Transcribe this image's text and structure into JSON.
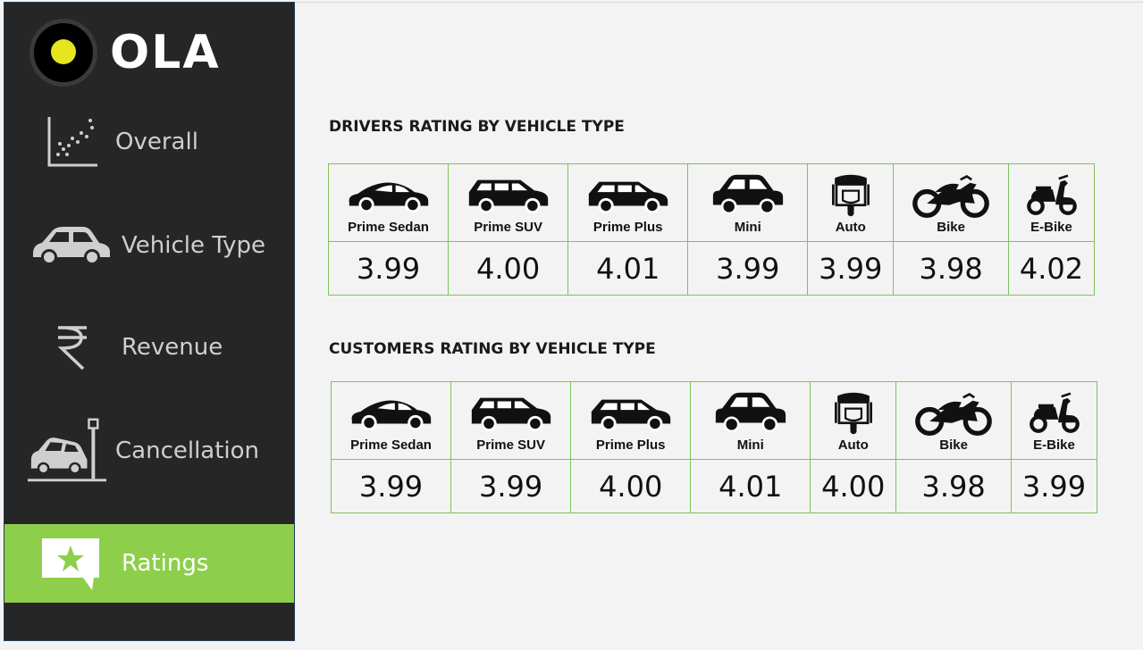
{
  "brand": {
    "logo_text": "OLA",
    "accent": "#8dcf4b",
    "logo_dot": "#e5e61f"
  },
  "nav": {
    "items": [
      {
        "label": "Overall",
        "icon": "scatter-chart-icon",
        "active": false
      },
      {
        "label": "Vehicle Type",
        "icon": "car-icon",
        "active": false
      },
      {
        "label": "Revenue",
        "icon": "rupee-icon",
        "active": false
      },
      {
        "label": "Cancellation",
        "icon": "car-crash-icon",
        "active": false
      },
      {
        "label": "Ratings",
        "icon": "star-message-icon",
        "active": true
      }
    ]
  },
  "drivers": {
    "title": "DRIVERS RATING BY VEHICLE TYPE",
    "vehicles": [
      {
        "name": "Prime Sedan",
        "icon": "sedan-icon",
        "rating": "3.99"
      },
      {
        "name": "Prime SUV",
        "icon": "suv-icon",
        "rating": "4.00"
      },
      {
        "name": "Prime Plus",
        "icon": "hatchback-icon",
        "rating": "4.01"
      },
      {
        "name": "Mini",
        "icon": "mini-car-icon",
        "rating": "3.99"
      },
      {
        "name": "Auto",
        "icon": "auto-rickshaw-icon",
        "rating": "3.99"
      },
      {
        "name": "Bike",
        "icon": "motorbike-icon",
        "rating": "3.98"
      },
      {
        "name": "E-Bike",
        "icon": "scooter-icon",
        "rating": "4.02"
      }
    ]
  },
  "customers": {
    "title": "CUSTOMERS RATING BY VEHICLE TYPE",
    "vehicles": [
      {
        "name": "Prime Sedan",
        "icon": "sedan-icon",
        "rating": "3.99"
      },
      {
        "name": "Prime SUV",
        "icon": "suv-icon",
        "rating": "3.99"
      },
      {
        "name": "Prime Plus",
        "icon": "hatchback-icon",
        "rating": "4.00"
      },
      {
        "name": "Mini",
        "icon": "mini-car-icon",
        "rating": "4.01"
      },
      {
        "name": "Auto",
        "icon": "auto-rickshaw-icon",
        "rating": "4.00"
      },
      {
        "name": "Bike",
        "icon": "motorbike-icon",
        "rating": "3.98"
      },
      {
        "name": "E-Bike",
        "icon": "scooter-icon",
        "rating": "3.99"
      }
    ]
  }
}
